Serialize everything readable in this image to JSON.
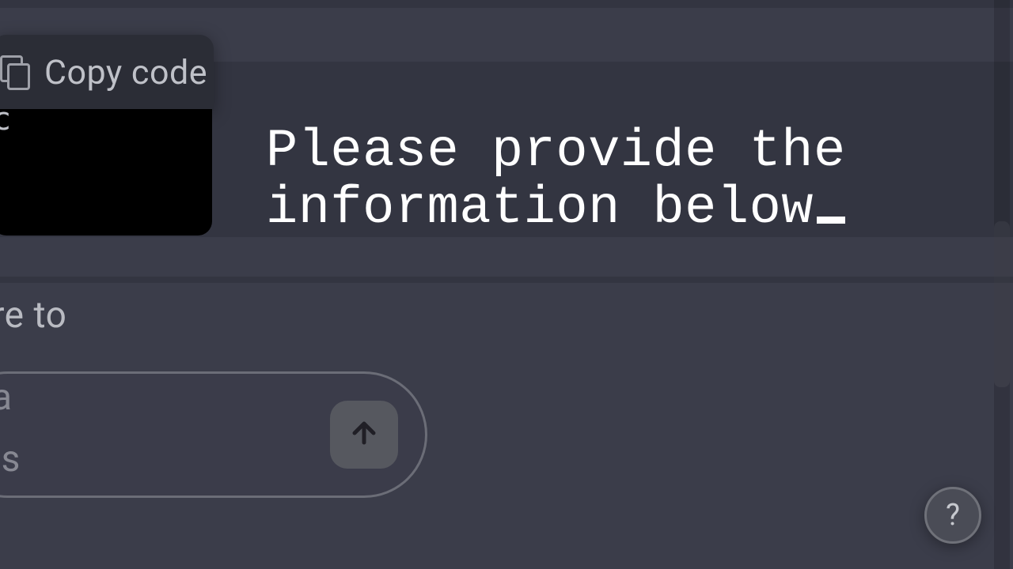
{
  "overlay": {
    "line1": "Please provide the",
    "line2": "information below"
  },
  "code_block": {
    "copy_label": "Copy code",
    "fragment_char": "c"
  },
  "background_fragments": {
    "f1": "re to",
    "f2": "a",
    "f3": "is"
  },
  "help": {
    "label": "?"
  },
  "icons": {
    "copy": "copy-icon",
    "send": "arrow-up-icon",
    "help": "help-icon"
  }
}
